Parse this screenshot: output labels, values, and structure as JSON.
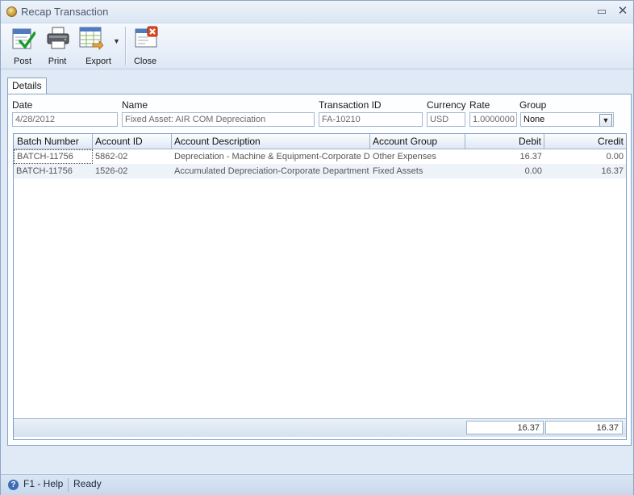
{
  "window": {
    "title": "Recap Transaction"
  },
  "toolbar": {
    "post_label": "Post",
    "print_label": "Print",
    "export_label": "Export",
    "close_label": "Close"
  },
  "tabs": [
    {
      "label": "Details"
    }
  ],
  "fields": {
    "date": {
      "label": "Date",
      "value": "4/28/2012"
    },
    "name": {
      "label": "Name",
      "value": "Fixed Asset: AIR COM Depreciation"
    },
    "transaction_id": {
      "label": "Transaction ID",
      "value": "FA-10210"
    },
    "currency": {
      "label": "Currency",
      "value": "USD"
    },
    "rate": {
      "label": "Rate",
      "value": "1.0000000"
    },
    "group": {
      "label": "Group",
      "value": "None"
    }
  },
  "grid": {
    "columns": [
      "Batch Number",
      "Account ID",
      "Account Description",
      "Account Group",
      "Debit",
      "Credit"
    ],
    "rows": [
      {
        "batch": "BATCH-11756",
        "account_id": "5862-02",
        "description": "Depreciation - Machine & Equipment-Corporate De",
        "group": "Other Expenses",
        "debit": "16.37",
        "credit": "0.00"
      },
      {
        "batch": "BATCH-11756",
        "account_id": "1526-02",
        "description": "Accumulated Depreciation-Corporate Department",
        "group": "Fixed Assets",
        "debit": "0.00",
        "credit": "16.37"
      }
    ],
    "totals": {
      "debit": "16.37",
      "credit": "16.37"
    }
  },
  "statusbar": {
    "help": "F1 - Help",
    "status": "Ready"
  },
  "icons": {
    "title": "recap-app-icon",
    "post": "post-checkmark-icon",
    "print": "printer-icon",
    "export": "spreadsheet-export-icon",
    "close": "close-form-icon",
    "help": "help-icon"
  }
}
